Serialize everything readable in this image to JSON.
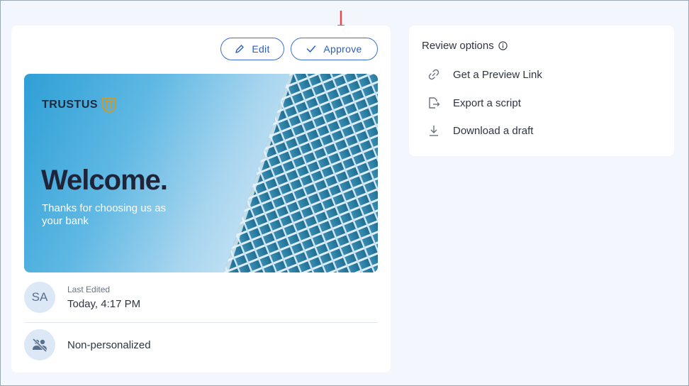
{
  "toolbar": {
    "edit_label": "Edit",
    "approve_label": "Approve"
  },
  "banner": {
    "brand": "TRUSTUS",
    "headline": "Welcome.",
    "tagline": "Thanks for choosing us as your bank"
  },
  "meta": {
    "avatar_initials": "SA",
    "last_edited_label": "Last Edited",
    "last_edited_value": "Today, 4:17 PM",
    "personalization": "Non-personalized"
  },
  "review": {
    "title": "Review options",
    "options": [
      {
        "label": "Get a Preview Link",
        "icon": "link-icon"
      },
      {
        "label": "Export a script",
        "icon": "export-icon"
      },
      {
        "label": "Download a draft",
        "icon": "download-icon"
      }
    ]
  },
  "colors": {
    "accent": "#3b6fd4",
    "arrow": "#e5484d",
    "background": "#f3f6fd"
  }
}
